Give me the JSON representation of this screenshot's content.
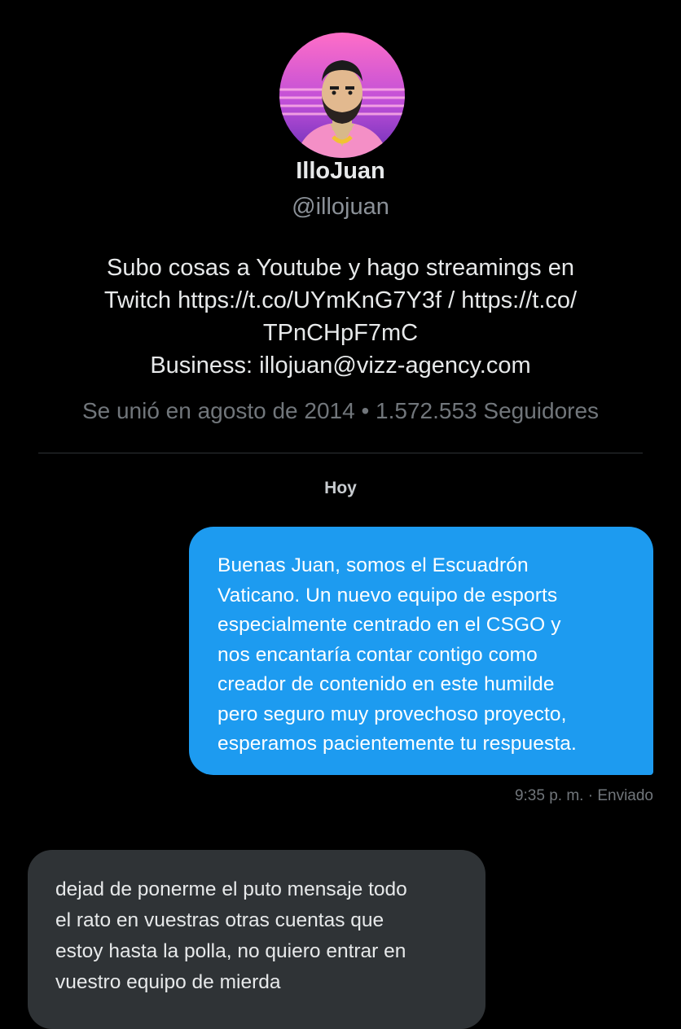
{
  "profile": {
    "display_name": "IlloJuan",
    "handle": "@illojuan",
    "bio_lines": [
      "Subo cosas a Youtube y hago streamings en",
      "Twitch https://t.co/UYmKnG7Y3f / https://t.co/",
      "TPnCHpF7mC",
      "Business: illojuan@vizz-agency.com"
    ],
    "joined": "Se unió en agosto de 2014",
    "separator": "•",
    "followers": "1.572.553 Seguidores"
  },
  "conversation": {
    "day_label": "Hoy",
    "sent_message": {
      "lines": [
        "Buenas Juan, somos el Escuadrón",
        "Vaticano. Un nuevo equipo de esports",
        "especialmente centrado en el CSGO y",
        "nos encantaría contar contigo como",
        "creador de contenido en este humilde",
        "pero seguro muy provechoso proyecto,",
        "esperamos pacientemente tu respuesta."
      ],
      "time": "9:35 p. m.",
      "status": "Enviado"
    },
    "received_message": {
      "lines": [
        "dejad de ponerme el puto mensaje todo",
        "el rato en vuestras otras cuentas que",
        "estoy hasta la polla, no quiero entrar en",
        "vuestro equipo de mierda"
      ]
    }
  },
  "colors": {
    "background": "#000000",
    "sent_bubble": "#1d9bf0",
    "received_bubble": "#2f3336",
    "muted_text": "#71767b"
  }
}
